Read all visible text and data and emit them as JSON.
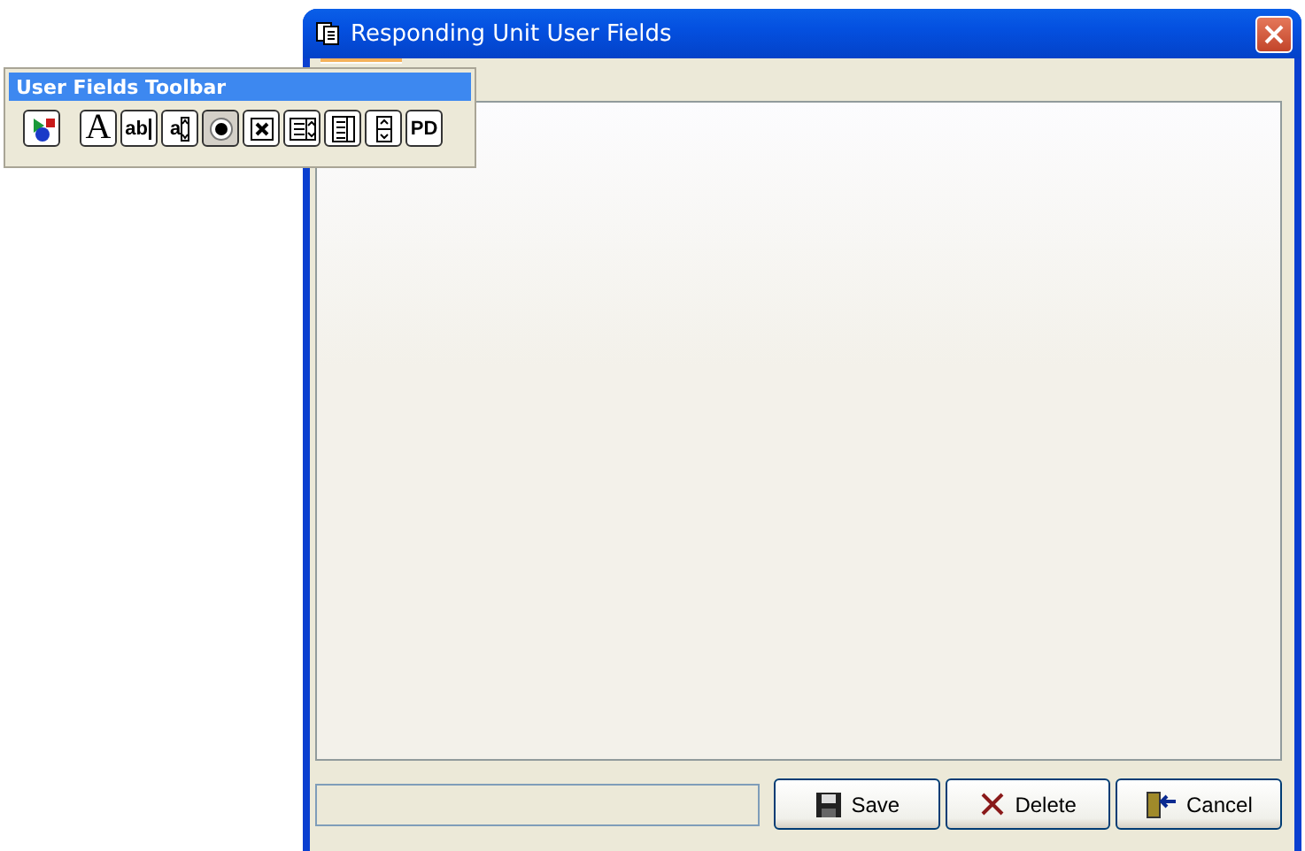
{
  "window": {
    "title": "Responding Unit User Fields"
  },
  "tabs": [
    {
      "selected": true
    }
  ],
  "toolbar": {
    "title": "User Fields Toolbar",
    "tools": [
      {
        "kind": "pointer"
      },
      {
        "kind": "glyph",
        "label": "A"
      },
      {
        "kind": "textbox",
        "label": "ab"
      },
      {
        "kind": "listbox",
        "label": "a"
      },
      {
        "kind": "radio"
      },
      {
        "kind": "checkbox"
      },
      {
        "kind": "combo"
      },
      {
        "kind": "list"
      },
      {
        "kind": "spinner"
      },
      {
        "kind": "glyph",
        "label": "PD"
      }
    ]
  },
  "status_bar": {
    "kind": "field"
  },
  "buttons": [
    {
      "kind": "save",
      "label": "Save"
    },
    {
      "kind": "delete",
      "label": "Delete"
    },
    {
      "kind": "cancel",
      "label": "Cancel"
    }
  ]
}
